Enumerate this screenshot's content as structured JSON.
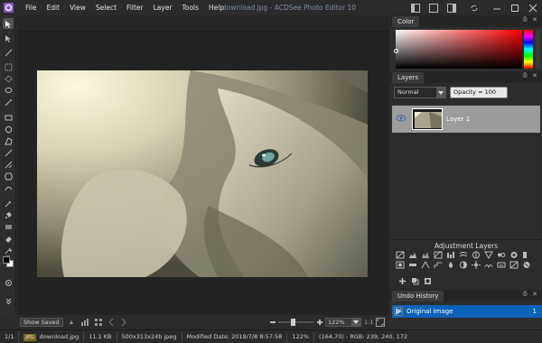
{
  "window": {
    "title": "download.jpg - ACDSee Photo Editor 10",
    "logo": "acdsee-logo-icon"
  },
  "menu": [
    "File",
    "Edit",
    "View",
    "Select",
    "Filter",
    "Layer",
    "Tools",
    "Help"
  ],
  "toolbar": {
    "tools": [
      "arrow-icon",
      "lasso-icon",
      "brush-icon",
      "marquee-icon",
      "magic-wand-icon",
      "ellipse-icon",
      "rectangle-icon",
      "polygon-icon",
      "line-icon",
      "gradient-icon",
      "shape-icon",
      "text-icon",
      "eyedropper-icon",
      "fill-icon",
      "clone-icon",
      "heal-icon",
      "eraser-icon",
      "color-picker-icon"
    ],
    "foreground_color": "#000000",
    "background_color": "#ffffff"
  },
  "navbar": {
    "save_label": "Show Saved",
    "zoom_value": "122%",
    "ratio_label": "1:1"
  },
  "statusbar": {
    "page": "1/1",
    "badge": "JPG",
    "filename": "download.jpg",
    "filesize": "11.1 KB",
    "dims": "500x313x24b jpeg",
    "modified": "Modified Date: 2019/7/8 8:57:58",
    "zoom": "122%",
    "pixel_info": "(164,70) - RGB: 239, 240, 172"
  },
  "panels": {
    "color": {
      "title": "Color",
      "hue": "#ff0000"
    },
    "layers": {
      "title": "Layers",
      "blend_mode": "Normal",
      "opacity_label": "Opacity = 100",
      "layer_name": "Layer 1"
    },
    "adjustment": {
      "title": "Adjustment Layers"
    },
    "undo": {
      "title": "Undo History",
      "item": "Original Image",
      "item_num": "1"
    }
  },
  "colors": {
    "accent": "#0b62b8",
    "title_text": "#7c8ea6",
    "selected_layer": "#9c9c9c"
  }
}
